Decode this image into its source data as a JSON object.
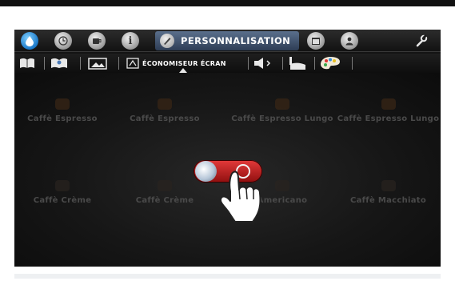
{
  "nav": {
    "active_tab_label": "PERSONNALISATION",
    "icons": [
      "water-drop-icon",
      "clock-icon",
      "cup-icon",
      "info-icon",
      "brush-icon",
      "calendar-icon",
      "user-icon",
      "wrench-icon"
    ]
  },
  "subnav": {
    "active_label": "ÉCONOMISEUR ÉCRAN",
    "icons": [
      "book-icon",
      "book-user-icon",
      "picture-icon",
      "screensaver-icon",
      "speaker-icon",
      "cup-steam-icon",
      "palette-icon"
    ]
  },
  "preview": {
    "beverages_row1": [
      "Caffè Espresso",
      "Caffè Espresso",
      "Caffè Espresso Lungo",
      "Caffè Espresso Lungo"
    ],
    "beverages_row2": [
      "Caffè Crème",
      "Caffè Crème",
      "Americano",
      "Caffè Macchiato"
    ]
  },
  "toggle": {
    "state": "on"
  },
  "colors": {
    "toggle_on": "#c81f1f",
    "active_tab": "#3e5170"
  }
}
